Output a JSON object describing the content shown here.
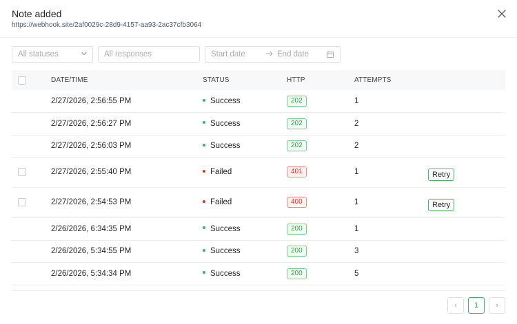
{
  "header": {
    "title": "Note added",
    "url": "https://webhook.site/2af0029c-28d9-4157-aa93-2ac37cfb3064"
  },
  "filters": {
    "status_placeholder": "All statuses",
    "response_placeholder": "All responses",
    "start_date_placeholder": "Start date",
    "end_date_placeholder": "End date"
  },
  "table": {
    "columns": [
      "DATE/TIME",
      "STATUS",
      "HTTP",
      "ATTEMPTS"
    ],
    "rows": [
      {
        "datetime": "2/27/2026, 2:56:55 PM",
        "status": "Success",
        "http": "202",
        "attempts": "1"
      },
      {
        "datetime": "2/27/2026, 2:56:27 PM",
        "status": "Success",
        "http": "202",
        "attempts": "2"
      },
      {
        "datetime": "2/27/2026, 2:56:03 PM",
        "status": "Success",
        "http": "202",
        "attempts": "2"
      },
      {
        "datetime": "2/27/2026, 2:55:40 PM",
        "status": "Failed",
        "http": "401",
        "attempts": "1",
        "action": "Retry"
      },
      {
        "datetime": "2/27/2026, 2:54:53 PM",
        "status": "Failed",
        "http": "400",
        "attempts": "1",
        "action": "Retry"
      },
      {
        "datetime": "2/26/2026, 6:34:35 PM",
        "status": "Success",
        "http": "200",
        "attempts": "1"
      },
      {
        "datetime": "2/26/2026, 5:34:55 PM",
        "status": "Success",
        "http": "200",
        "attempts": "3"
      },
      {
        "datetime": "2/26/2026, 5:34:34 PM",
        "status": "Success",
        "http": "200",
        "attempts": "5"
      }
    ]
  },
  "pagination": {
    "current_page": "1",
    "prev_glyph": "‹",
    "next_glyph": "›"
  },
  "colors": {
    "success": "#3fb35a",
    "failed": "#e03131"
  },
  "icons": {
    "close": "close-icon",
    "dropdown": "chevron-down-icon",
    "calendar": "calendar-icon",
    "arrow": "arrow-right-icon"
  }
}
